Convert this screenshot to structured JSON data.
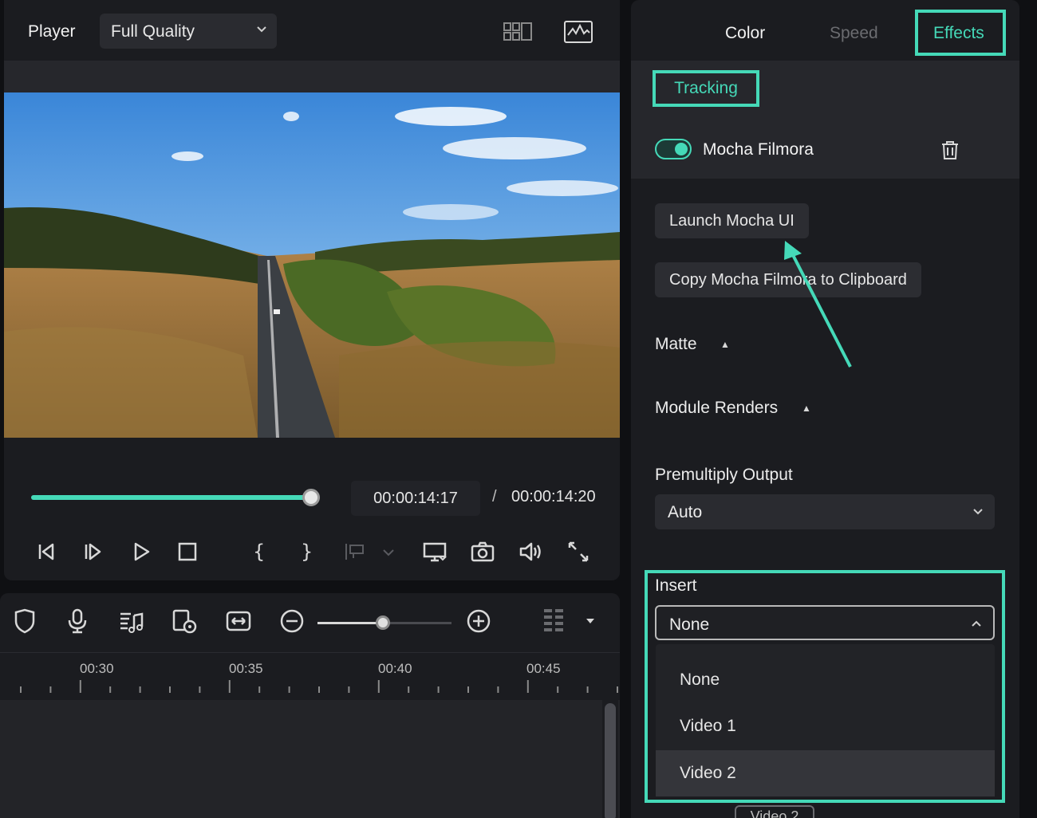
{
  "player": {
    "title": "Player",
    "quality": "Full Quality",
    "time_current": "00:00:14:17",
    "time_separator": "/",
    "time_total": "00:00:14:20",
    "progress_fraction": 0.99
  },
  "timeline": {
    "ruler_labels": [
      "00:30",
      "00:35",
      "00:40",
      "00:45"
    ],
    "zoom_fraction": 0.49
  },
  "right_panel": {
    "tabs": [
      {
        "label": "Color",
        "state": "normal"
      },
      {
        "label": "Speed",
        "state": "disabled"
      },
      {
        "label": "Effects",
        "state": "active"
      }
    ],
    "subtab": "Tracking",
    "effect": {
      "name": "Mocha Filmora",
      "enabled": true
    },
    "buttons": {
      "launch": "Launch Mocha UI",
      "copy": "Copy Mocha Filmora to Clipboard"
    },
    "sections": {
      "matte": "Matte",
      "module_renders": "Module Renders",
      "premultiply_output": "Premultiply Output",
      "premultiply_value": "Auto",
      "insert": "Insert",
      "insert_value": "None"
    },
    "insert_options": [
      "None",
      "Video 1",
      "Video 2"
    ],
    "insert_hovered": "Video 2",
    "behind_item": "Video 2"
  },
  "colors": {
    "accent": "#45d9b8",
    "panel": "#1b1c20",
    "panel_alt": "#26272c"
  },
  "icons": {
    "header": [
      "grid-view-icon",
      "waveform-image-icon"
    ],
    "playback": [
      "prev-frame-icon",
      "next-frame-icon",
      "play-icon",
      "stop-icon",
      "mark-in-icon",
      "mark-out-icon",
      "insert-marker-icon",
      "display-icon",
      "snapshot-icon",
      "volume-icon",
      "fullscreen-icon"
    ],
    "timeline": [
      "shield-icon",
      "microphone-icon",
      "audio-list-icon",
      "clip-replace-icon",
      "fit-icon",
      "zoom-out-icon",
      "zoom-in-icon",
      "grip-icon"
    ]
  }
}
